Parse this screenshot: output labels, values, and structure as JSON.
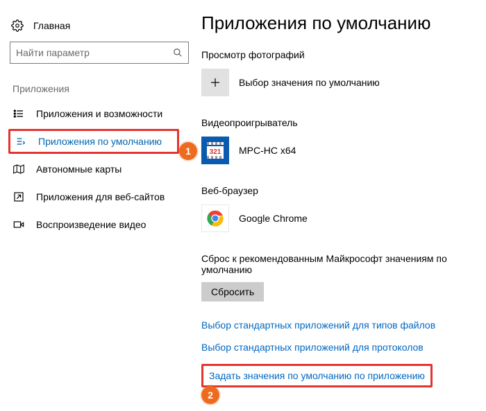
{
  "sidebar": {
    "home": "Главная",
    "search_placeholder": "Найти параметр",
    "group_title": "Приложения",
    "items": [
      {
        "label": "Приложения и возможности"
      },
      {
        "label": "Приложения по умолчанию"
      },
      {
        "label": "Автономные карты"
      },
      {
        "label": "Приложения для веб-сайтов"
      },
      {
        "label": "Воспроизведение видео"
      }
    ]
  },
  "markers": {
    "one": "1",
    "two": "2"
  },
  "main": {
    "title": "Приложения по умолчанию",
    "photo": {
      "heading": "Просмотр фотографий",
      "button": "Выбор значения по умолчанию"
    },
    "video": {
      "heading": "Видеопроигрыватель",
      "app": "MPC-HC x64"
    },
    "browser": {
      "heading": "Веб-браузер",
      "app": "Google Chrome"
    },
    "reset": {
      "desc": "Сброс к рекомендованным Майкрософт значениям по умолчанию",
      "button": "Сбросить"
    },
    "links": {
      "filetypes": "Выбор стандартных приложений для типов файлов",
      "protocols": "Выбор стандартных приложений для протоколов",
      "by_app": "Задать значения по умолчанию по приложению"
    }
  }
}
